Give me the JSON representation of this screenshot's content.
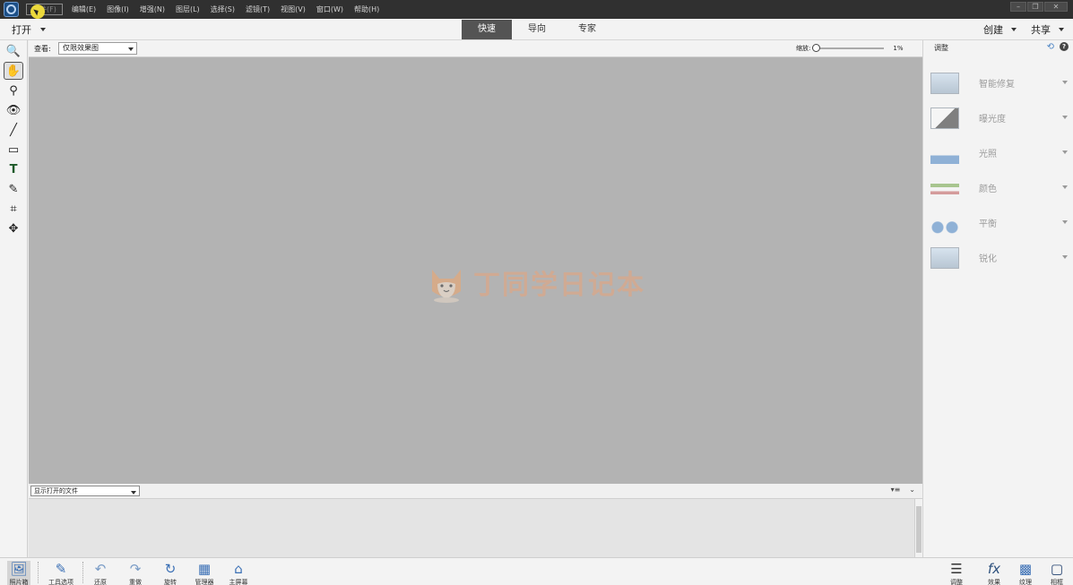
{
  "menu": {
    "items": [
      "文件(F)",
      "编辑(E)",
      "图像(I)",
      "增强(N)",
      "图层(L)",
      "选择(S)",
      "滤镜(T)",
      "视图(V)",
      "窗口(W)",
      "帮助(H)"
    ],
    "window_controls": [
      "–",
      "❐",
      "✕"
    ]
  },
  "modebar": {
    "open_label": "打开",
    "tabs": [
      "快速",
      "导向",
      "专家"
    ],
    "active_tab": "快速",
    "create_label": "创建",
    "share_label": "共享"
  },
  "toolbar": {
    "tools": [
      {
        "name": "zoom-tool",
        "glyph": "🔍"
      },
      {
        "name": "hand-tool",
        "glyph": "✋"
      },
      {
        "name": "quick-selection-tool",
        "glyph": "⚲"
      },
      {
        "name": "red-eye-tool",
        "glyph": "👁"
      },
      {
        "name": "whiten-teeth-tool",
        "glyph": "╱"
      },
      {
        "name": "straighten-tool",
        "glyph": "▭"
      },
      {
        "name": "type-tool",
        "glyph": "T"
      },
      {
        "name": "spot-healing-tool",
        "glyph": "✎"
      },
      {
        "name": "crop-tool",
        "glyph": "⌗"
      },
      {
        "name": "move-tool",
        "glyph": "✥"
      }
    ]
  },
  "options": {
    "view_label": "查看:",
    "view_value": "仅限效果图",
    "zoom_label": "缩放:",
    "zoom_value": "1%"
  },
  "watermark": {
    "text": "丁同学日记本"
  },
  "bin": {
    "files_select_value": "显示打开的文件"
  },
  "panel": {
    "title": "调整",
    "adjustments": [
      "智能修复",
      "曝光度",
      "光照",
      "颜色",
      "平衡",
      "锐化"
    ]
  },
  "taskbar": {
    "left": [
      {
        "name": "photo-bin",
        "label": "照片箱",
        "glyph": "🖼"
      },
      {
        "name": "tool-options",
        "label": "工具选项",
        "glyph": "✎"
      },
      {
        "name": "undo",
        "label": "还原",
        "glyph": "↶"
      },
      {
        "name": "redo",
        "label": "重做",
        "glyph": "↷"
      },
      {
        "name": "rotate",
        "label": "旋转",
        "glyph": "↻"
      },
      {
        "name": "organizer",
        "label": "管理器",
        "glyph": "▦"
      },
      {
        "name": "home-screen",
        "label": "主屏幕",
        "glyph": "⌂"
      }
    ],
    "right": [
      {
        "name": "adjustments",
        "label": "调整",
        "glyph": "☰"
      },
      {
        "name": "effects",
        "label": "效果",
        "glyph": "fx"
      },
      {
        "name": "textures",
        "label": "纹理",
        "glyph": "▩"
      },
      {
        "name": "frames",
        "label": "相框",
        "glyph": "▢"
      }
    ]
  }
}
